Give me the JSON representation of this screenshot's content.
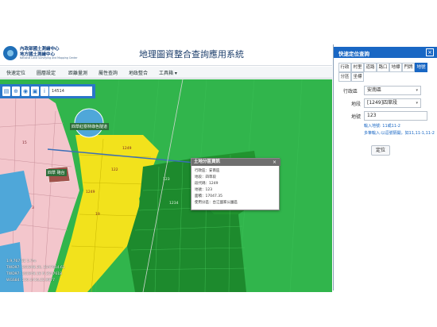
{
  "header": {
    "logo_line1": "內政部國土測繪中心",
    "logo_line2": "地方國土測繪中心",
    "logo_line3": "National Land Surveying and Mapping Center",
    "app_title": "地理圖資整合查詢應用系統"
  },
  "menu": {
    "items": [
      "快速定位",
      "圖層設定",
      "距離量測",
      "屬性查詢",
      "地政整合",
      "工具箱"
    ]
  },
  "map": {
    "scale_input": "14514",
    "place_labels": [
      "四草紅樹林綠色隧道",
      "四草 砲台"
    ],
    "parcel_labels": [
      "1249",
      "122",
      "1249",
      "123",
      "1234",
      "19",
      "15",
      "3"
    ],
    "colors": {
      "map_green": "#2fb24a",
      "parcel_dark": "#1d8a2d",
      "urban_yellow": "#f2e21c",
      "urban_pink": "#f3c6cc",
      "water_blue": "#4fa7d9"
    }
  },
  "popup": {
    "title": "土地分區資訊",
    "close": "×",
    "lines": [
      "行政區：安南區",
      "地段：四草段",
      "段代碼：1249",
      "地號：123",
      "面積：17047.35",
      "使用分區：台江國家公園區"
    ]
  },
  "coords": {
    "lines": [
      "1:9,767 SE 5.7m",
      "TWD97: 161848.30, 2547614.61",
      "TWD97: 161948.18 N 2547618",
      "WGS84: 120.1416,22.9877"
    ]
  },
  "panel": {
    "title": "快速定位查詢",
    "close": "×",
    "tabs_row1": [
      "行政",
      "村里",
      "道路",
      "路口",
      "地標",
      "門牌",
      "地號"
    ],
    "tabs_row2": [
      "分區",
      "坐標"
    ],
    "active_tab": "地號",
    "district_label": "行政區",
    "district_value": "安南區",
    "section_label": "地段",
    "section_value": "[1249]四草段",
    "number_label": "地號",
    "number_value": "123",
    "hint1": "輸入地號: 11或11-2",
    "hint2": "多筆輸入:以逗號隔開，如11,11-1,11-2",
    "locate_button": "定位",
    "colors": {
      "accent": "#1967c4"
    }
  }
}
